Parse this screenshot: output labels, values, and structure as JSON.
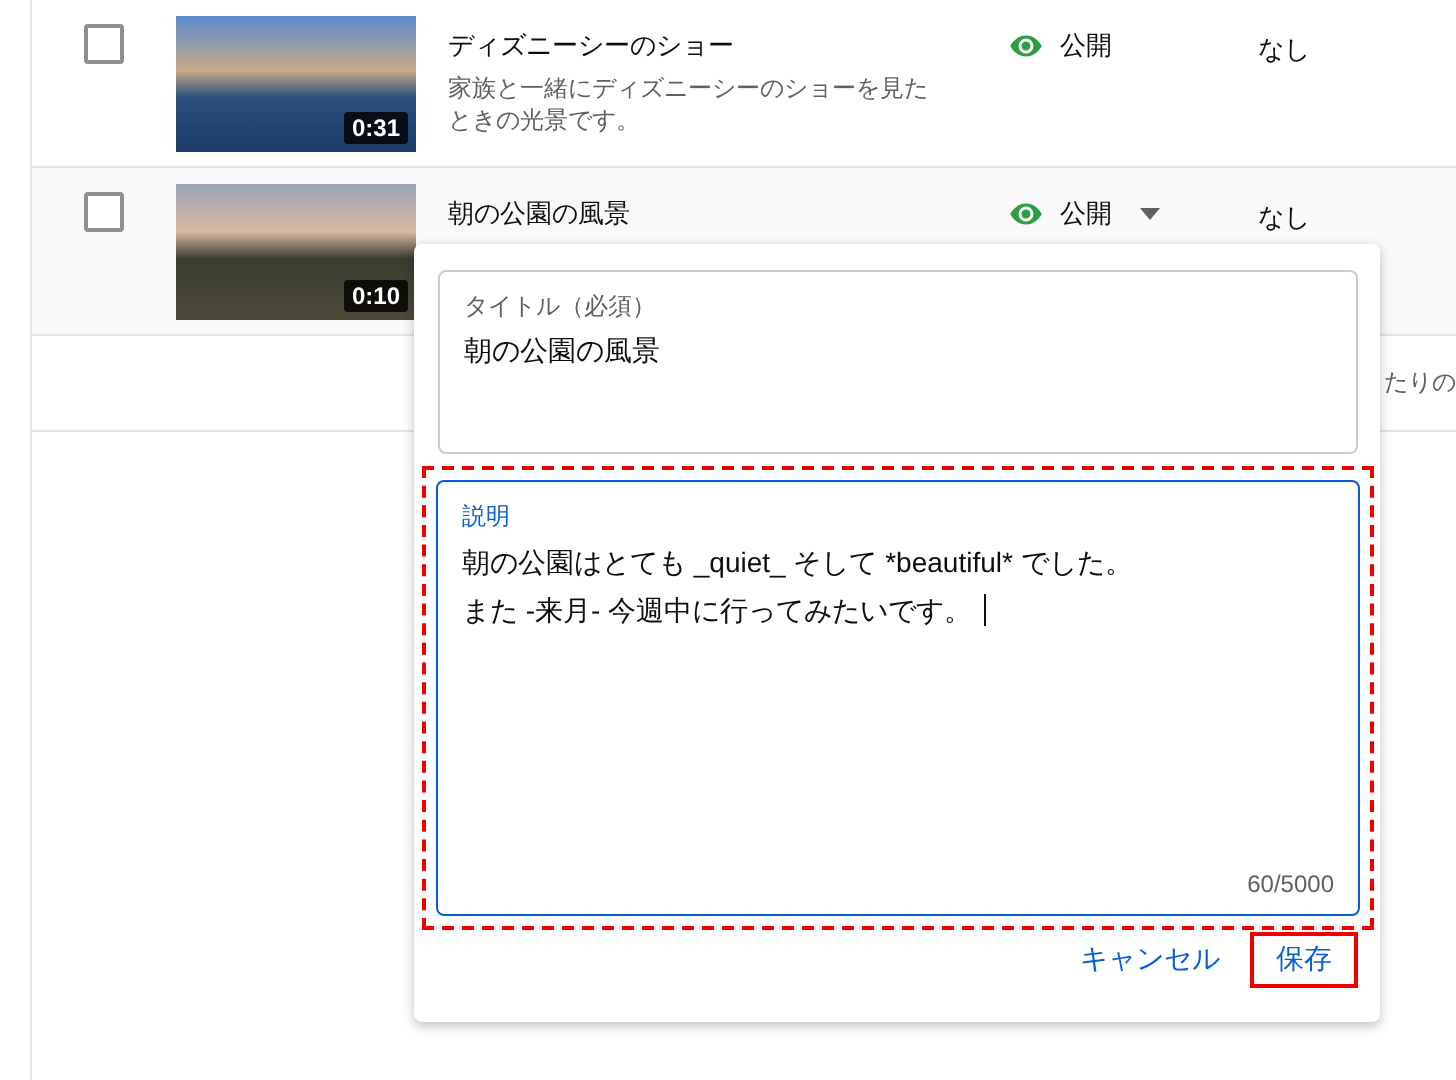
{
  "videos": [
    {
      "checked": false,
      "hovered": false,
      "duration": "0:31",
      "title": "ディズニーシーのショー",
      "description": "家族と一緒にディズニーシーのショーを見たときの光景です。",
      "visibility": "公開",
      "restrictions": "なし"
    },
    {
      "checked": false,
      "hovered": true,
      "duration": "0:10",
      "title": "朝の公園の風景",
      "visibility": "公開",
      "restrictions": "なし"
    }
  ],
  "footer_text": "たりの",
  "editor": {
    "title_field": {
      "label": "タイトル（必須）",
      "value": "朝の公園の風景"
    },
    "description_field": {
      "label": "説明",
      "lines": [
        "朝の公園はとても _quiet_ そして *beautiful* でした。",
        "また -来月- 今週中に行ってみたいです。"
      ],
      "counter": "60/5000",
      "highlighted": true
    },
    "buttons": [
      {
        "label": "キャンセル",
        "highlighted": false
      },
      {
        "label": "保存",
        "highlighted": true
      }
    ]
  }
}
